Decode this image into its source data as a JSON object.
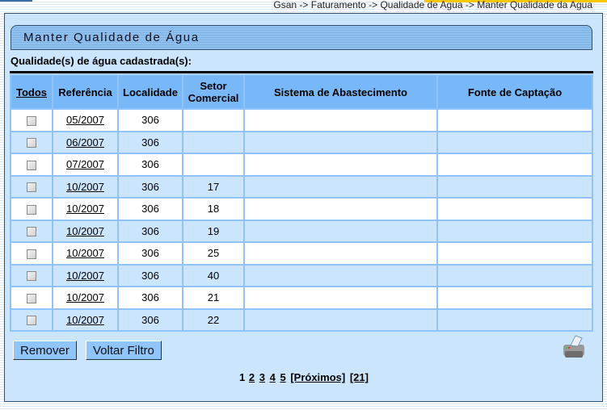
{
  "breadcrumb": "Gsan -> Faturamento -> Qualidade de Agua -> Manter Qualidade da Agua",
  "title": "Manter Qualidade de Água",
  "subtitle": "Qualidade(s) de água cadastrada(s):",
  "columns": [
    "Todos",
    "Referência",
    "Localidade",
    "Setor Comercial",
    "Sistema de Abastecimento",
    "Fonte de Captação"
  ],
  "rows": [
    {
      "ref": "05/2007",
      "loc": "306",
      "setor": "",
      "sistema": "",
      "fonte": ""
    },
    {
      "ref": "06/2007",
      "loc": "306",
      "setor": "",
      "sistema": "",
      "fonte": ""
    },
    {
      "ref": "07/2007",
      "loc": "306",
      "setor": "",
      "sistema": "",
      "fonte": ""
    },
    {
      "ref": "10/2007",
      "loc": "306",
      "setor": "17",
      "sistema": "",
      "fonte": ""
    },
    {
      "ref": "10/2007",
      "loc": "306",
      "setor": "18",
      "sistema": "",
      "fonte": ""
    },
    {
      "ref": "10/2007",
      "loc": "306",
      "setor": "19",
      "sistema": "",
      "fonte": ""
    },
    {
      "ref": "10/2007",
      "loc": "306",
      "setor": "25",
      "sistema": "",
      "fonte": ""
    },
    {
      "ref": "10/2007",
      "loc": "306",
      "setor": "40",
      "sistema": "",
      "fonte": ""
    },
    {
      "ref": "10/2007",
      "loc": "306",
      "setor": "21",
      "sistema": "",
      "fonte": ""
    },
    {
      "ref": "10/2007",
      "loc": "306",
      "setor": "22",
      "sistema": "",
      "fonte": ""
    }
  ],
  "buttons": {
    "remover": "Remover",
    "voltar": "Voltar Filtro"
  },
  "pager": {
    "current": "1",
    "pages": [
      "2",
      "3",
      "4",
      "5"
    ],
    "next": "[Próximos]",
    "last": "[21]"
  },
  "icons": {
    "print": "printer-icon"
  }
}
